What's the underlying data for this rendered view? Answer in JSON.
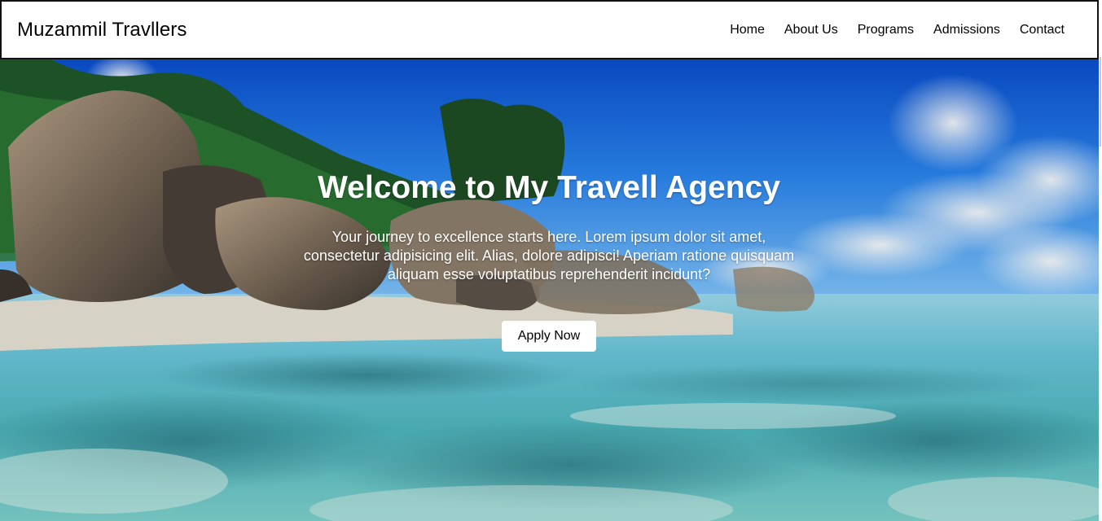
{
  "navbar": {
    "brand": "Muzammil Travllers",
    "links": [
      "Home",
      "About Us",
      "Programs",
      "Admissions",
      "Contact"
    ]
  },
  "hero": {
    "title": "Welcome to My Travell Agency",
    "text": "Your journey to excellence starts here. Lorem ipsum dolor sit amet, consectetur adipisicing elit. Alias, dolore adipisci! Aperiam ratione quisquam aliquam esse voluptatibus reprehenderit incidunt?",
    "button_label": "Apply Now",
    "background_image": "tropical-beach-photo"
  },
  "colors": {
    "navbar_bg": "#ffffff",
    "hero_text": "#ffffff",
    "sky": "#1f6fe0",
    "water": "#5fc4c8"
  }
}
